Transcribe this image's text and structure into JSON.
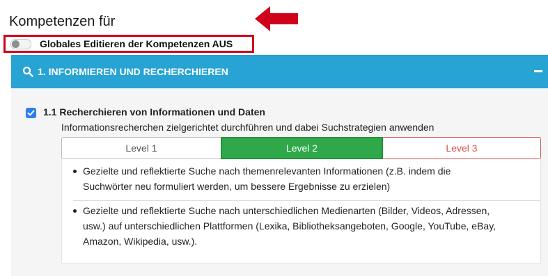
{
  "page_title": "Kompetenzen für",
  "global_toggle": {
    "label": "Globales Editieren der Kompetenzen AUS",
    "state": "off"
  },
  "accordion": {
    "title": "1. INFORMIEREN UND RECHERCHIEREN",
    "icon": "search-icon",
    "collapse_icon": "minus-icon",
    "color": "#27a3d4"
  },
  "competency": {
    "title": "1.1 Recherchieren von Informationen und Daten",
    "description": "Informationsrecherchen zielgerichtet durchführen und dabei Suchstrategien anwenden",
    "checked": true
  },
  "levels": [
    {
      "label": "Level 1"
    },
    {
      "label": "Level 2",
      "selected": true
    },
    {
      "label": "Level 3"
    }
  ],
  "level_items": [
    {
      "line1": "Gezielte und reflektierte Suche nach themenrelevanten Informationen (z.B. indem die",
      "line2": "Suchwörter neu formuliert werden, um bessere Ergebnisse zu erzielen)"
    },
    {
      "line1": "Gezielte und reflektierte Suche nach unterschiedlichen Medienarten (Bilder, Videos, Adressen,",
      "line2": "usw.) auf unterschiedlichen Plattformen (Lexika, Bibliotheksangeboten, Google, YouTube, eBay,",
      "line3": "Amazon, Wikipedia, usw.)."
    }
  ]
}
